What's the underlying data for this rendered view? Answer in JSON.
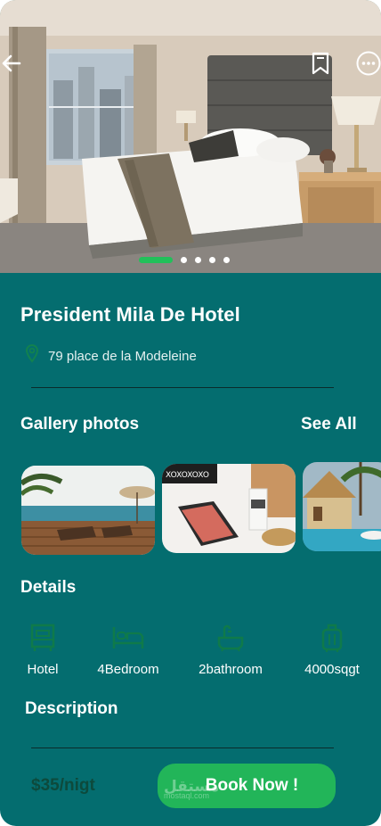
{
  "hero": {
    "back_icon": "arrow-left-icon",
    "bookmark_icon": "bookmark-icon",
    "more_icon": "more-horizontal-icon",
    "carousel": {
      "count": 5,
      "active": 1
    }
  },
  "hotel": {
    "name": "President Mila De Hotel",
    "address": "79 place de la Modeleine",
    "location_icon": "location-pin-icon"
  },
  "gallery": {
    "title": "Gallery photos",
    "see_all": "See All",
    "photos": [
      "pool-terrace-photo",
      "tablet-desk-photo",
      "resort-pool-photo"
    ]
  },
  "details": {
    "title": "Details",
    "items": [
      {
        "label": "Hotel",
        "icon": "hotel-icon"
      },
      {
        "label": "4Bedroom",
        "icon": "bed-icon"
      },
      {
        "label": "2bathroom",
        "icon": "bathtub-icon"
      },
      {
        "label": "4000sqgt",
        "icon": "luggage-icon"
      }
    ]
  },
  "description": {
    "title": "Description"
  },
  "booking": {
    "price": "$35/nigt",
    "button_label": "Book Now !"
  },
  "watermark": {
    "line1": "مستقل",
    "line2": "mostaql.com"
  },
  "colors": {
    "background": "#046d6f",
    "accent": "#22b559",
    "price_text": "#0d4a3c",
    "icon_green": "#0f7a4a"
  }
}
